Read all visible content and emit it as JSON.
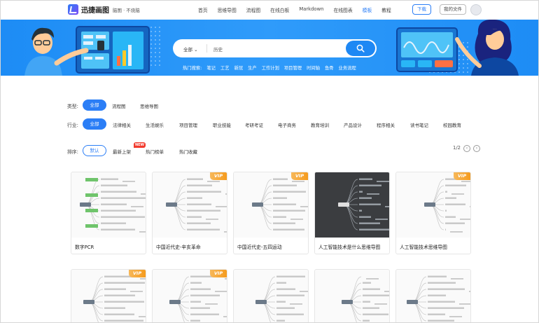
{
  "header": {
    "logo_text": "迅捷画图",
    "logo_tagline": "脑图 · 不烧脑",
    "nav": [
      "首页",
      "思维导图",
      "流程图",
      "在线白板",
      "Markdown",
      "在线图表",
      "模板",
      "教程"
    ],
    "nav_active_index": 6,
    "download_label": "下载",
    "my_files_label": "我的文件"
  },
  "search": {
    "scope": "全部",
    "placeholder": "历史",
    "hot_label": "热门搜索:",
    "hot_terms": [
      "笔记",
      "工艺",
      "新冠",
      "生产",
      "工作计划",
      "项目管理",
      "时间轴",
      "鱼骨",
      "业务流程"
    ]
  },
  "filters": {
    "type_label": "类型:",
    "types": [
      "全部",
      "流程图",
      "思维导图"
    ],
    "industry_label": "行业:",
    "industries": [
      "全部",
      "法律相关",
      "生活娱乐",
      "项目管理",
      "职业技能",
      "考研考证",
      "电子商务",
      "教育培训",
      "产品设计",
      "程序相关",
      "读书笔记",
      "校园教育"
    ],
    "sort_label": "排序:",
    "sorts": [
      "默认",
      "最新上架",
      "热门榜单",
      "热门收藏"
    ],
    "new_badge": "NEW",
    "page_indicator": "1/2"
  },
  "templates": [
    {
      "title": "数字PCR",
      "vip": false,
      "dark": false
    },
    {
      "title": "中国近代史-辛亥革命",
      "vip": true,
      "dark": false
    },
    {
      "title": "中国近代史-五四运动",
      "vip": true,
      "dark": false
    },
    {
      "title": "人工智能技术是什么思维导图",
      "vip": false,
      "dark": true
    },
    {
      "title": "人工智能技术思维导图",
      "vip": true,
      "dark": false
    },
    {
      "title": "",
      "vip": true,
      "dark": false
    },
    {
      "title": "",
      "vip": true,
      "dark": false
    },
    {
      "title": "",
      "vip": false,
      "dark": false
    },
    {
      "title": "",
      "vip": false,
      "dark": false
    },
    {
      "title": "",
      "vip": false,
      "dark": false
    }
  ],
  "vip_label": "VIP",
  "colors": {
    "accent": "#2b7ef6",
    "banner": "#1d8cf5",
    "vip": "#f59b1d",
    "new": "#f23b2e"
  }
}
